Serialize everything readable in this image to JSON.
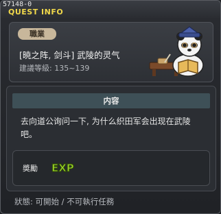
{
  "window": {
    "quest_id": "57148-0",
    "title": "QUEST INFO"
  },
  "quest": {
    "job_label": "職業",
    "name": "[暁之阵, 剑斗] 武陵的灵气",
    "level_text": "建議等級: 135~139",
    "npc_icon": "panda-scholar-npc"
  },
  "content": {
    "header": "内容",
    "description": "去向道公询问一下, 为什么织田军会出现在武陵吧。"
  },
  "reward": {
    "label": "奬勵",
    "exp_text": "EXP",
    "exp_icon": "exp-icon"
  },
  "status": {
    "text": "狀態: 可開始 / 不可執行任務"
  },
  "colors": {
    "title": "#f0d84a",
    "exp": "#9ad32a",
    "header_bg": "#3e5057",
    "badge_bg": "#c8b79b"
  }
}
